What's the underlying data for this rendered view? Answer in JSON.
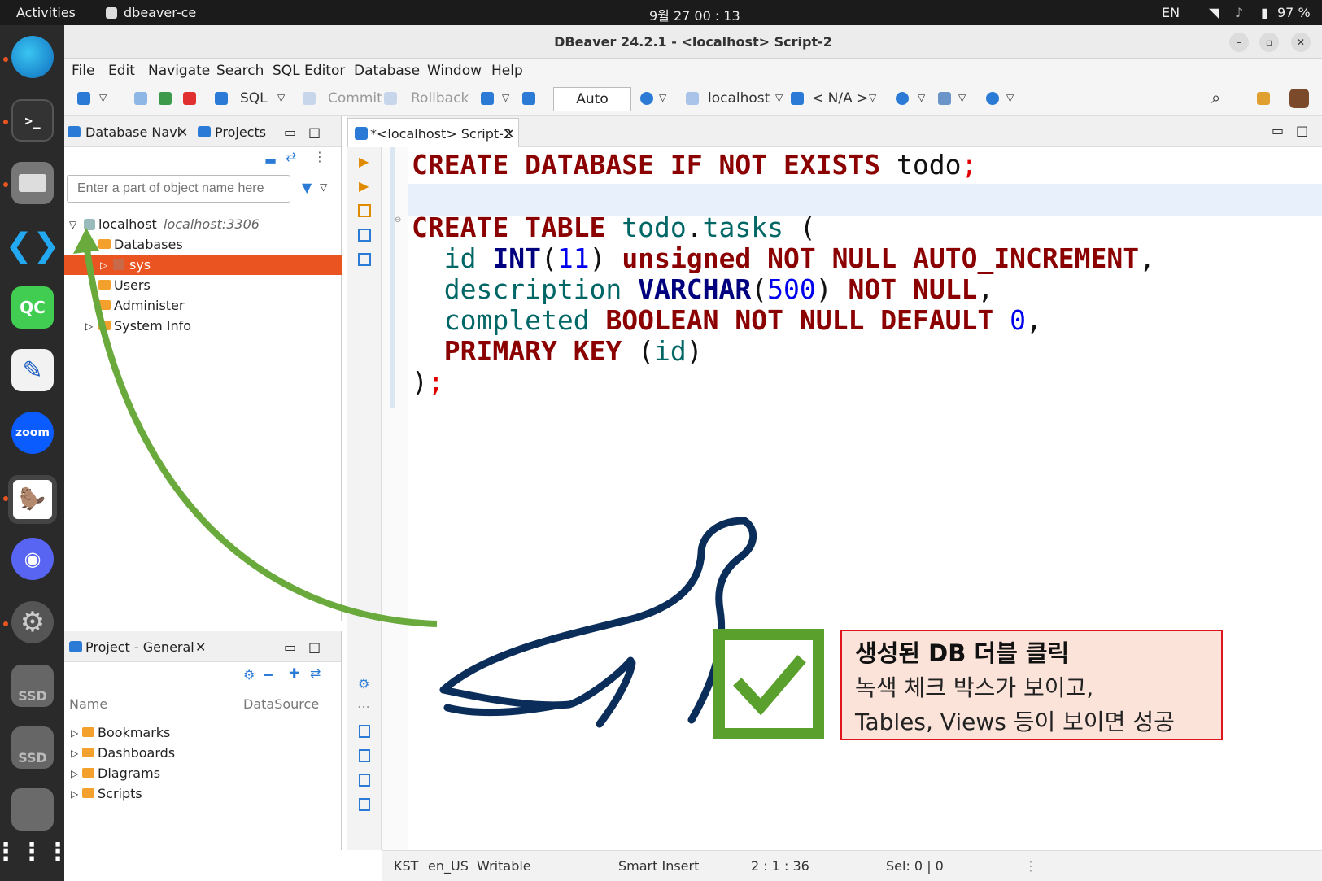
{
  "topbar": {
    "activities": "Activities",
    "app_name": "dbeaver-ce",
    "clock": "9월 27  00 : 13",
    "lang": "EN",
    "battery": "97 %"
  },
  "window": {
    "title": "DBeaver 24.2.1 - <localhost> Script-2"
  },
  "menu": [
    "File",
    "Edit",
    "Navigate",
    "Search",
    "SQL Editor",
    "Database",
    "Window",
    "Help"
  ],
  "toolbar": {
    "sql": "SQL",
    "commit": "Commit",
    "rollback": "Rollback",
    "auto": "Auto",
    "connection": "localhost",
    "schema": "< N/A >"
  },
  "navigator": {
    "tab_label": "Database Navi",
    "projects_tab": "Projects",
    "search_placeholder": "Enter a part of object name here",
    "connection_name": "localhost",
    "connection_host": "localhost:3306",
    "tree": [
      "Databases",
      "sys",
      "Users",
      "Administer",
      "System Info"
    ]
  },
  "project_panel": {
    "tab_label": "Project - General",
    "col_name": "Name",
    "col_datasource": "DataSource",
    "items": [
      "Bookmarks",
      "Dashboards",
      "Diagrams",
      "Scripts"
    ]
  },
  "editor": {
    "tab_label": "*<localhost> Script-2"
  },
  "status": {
    "tz": "KST",
    "locale": "en_US",
    "mode": "Writable",
    "insert": "Smart Insert",
    "pos": "2 : 1 : 36",
    "sel": "Sel: 0 | 0"
  },
  "note": {
    "title": "생성된 DB 더블 클릭",
    "line1": "녹색 체크 박스가 보이고,",
    "line2": "Tables, Views 등이 보이면 성공"
  },
  "dock": {
    "zoom": "zoom",
    "qc": "QC",
    "ssd": "SSD"
  }
}
